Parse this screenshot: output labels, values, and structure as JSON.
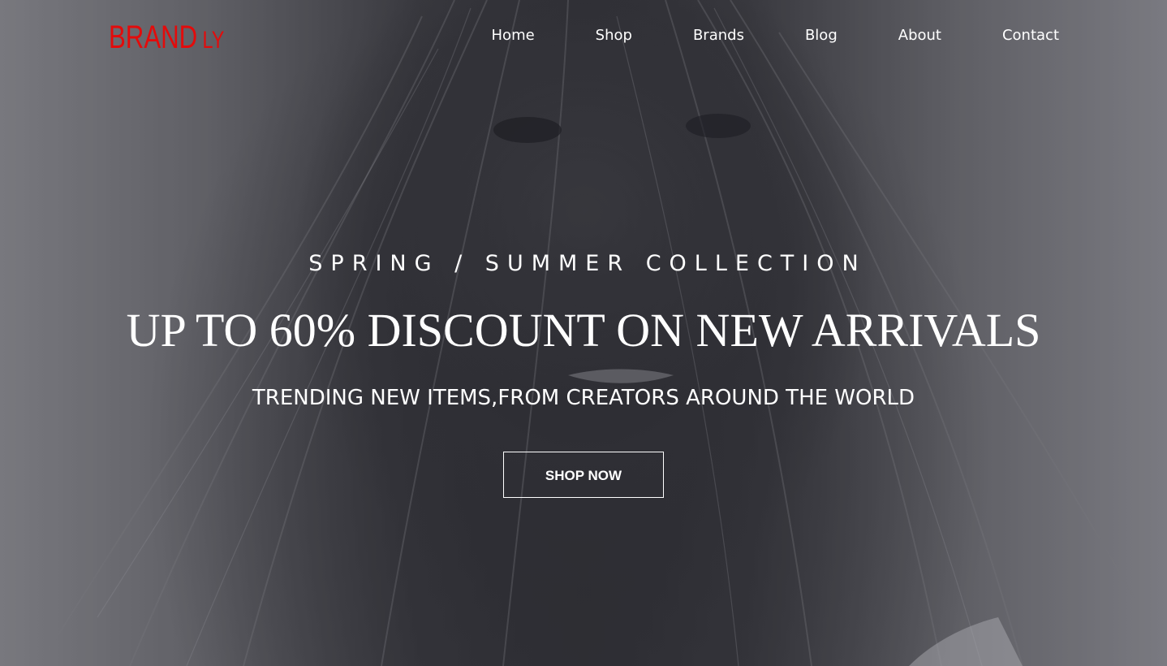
{
  "brand": {
    "name": "BRAND",
    "suffix": "LY",
    "color": "#e30b0b"
  },
  "nav": {
    "items": [
      {
        "label": "Home"
      },
      {
        "label": "Shop"
      },
      {
        "label": "Brands"
      },
      {
        "label": "Blog"
      },
      {
        "label": "About"
      },
      {
        "label": "Contact"
      }
    ]
  },
  "hero": {
    "eyebrow": "SPRING / SUMMER COLLECTION",
    "headline": "UP TO 60% DISCOUNT ON NEW ARRIVALS",
    "subline": "TRENDING NEW ITEMS,FROM CREATORS AROUND THE WORLD",
    "cta_label": "SHOP NOW",
    "background_image": "grayscale portrait of woman with hair across face"
  }
}
